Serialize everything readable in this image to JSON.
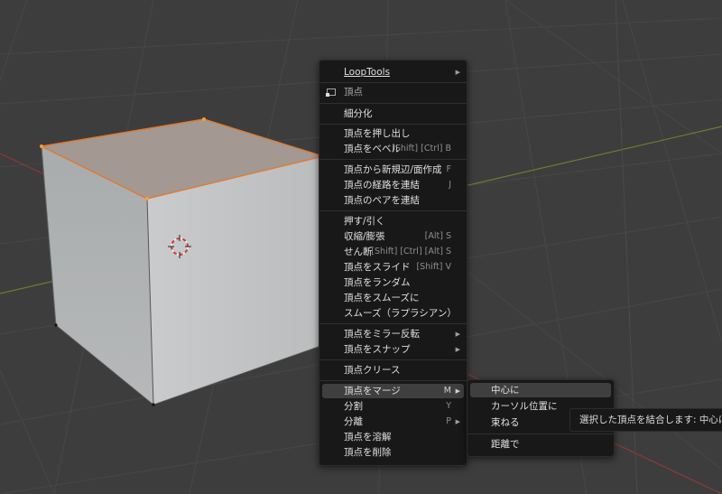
{
  "colors": {
    "background": "#3d3d3d",
    "menu_bg": "#181818",
    "highlight": "#3f3f3f",
    "selection_orange": "#e07a2e"
  },
  "main_menu": {
    "title": "頂点",
    "title_icon": "vertex-select-icon",
    "items": [
      {
        "label": "LoopTools",
        "arrow": "▶"
      },
      {
        "label": "細分化"
      },
      {
        "label": "頂点を押し出し"
      },
      {
        "label": "頂点をベベル",
        "shortcut": "[Shift] [Ctrl] B"
      },
      {
        "label": "頂点から新規辺/面作成",
        "shortcut": "F"
      },
      {
        "label": "頂点の経路を連結",
        "shortcut": "J"
      },
      {
        "label": "頂点のペアを連結"
      },
      {
        "label": "押す/引く"
      },
      {
        "label": "収縮/膨張",
        "shortcut": "[Alt] S"
      },
      {
        "label": "せん断",
        "shortcut": "[Shift] [Ctrl] [Alt] S"
      },
      {
        "label": "頂点をスライド",
        "shortcut": "[Shift] V"
      },
      {
        "label": "頂点をランダム"
      },
      {
        "label": "頂点をスムーズに"
      },
      {
        "label": "スムーズ（ラプラシアン）"
      },
      {
        "label": "頂点をミラー反転",
        "arrow": "▶"
      },
      {
        "label": "頂点をスナップ",
        "arrow": "▶"
      },
      {
        "label": "頂点クリース"
      },
      {
        "label": "頂点をマージ",
        "shortcut": "M",
        "arrow": "▶"
      },
      {
        "label": "分割",
        "shortcut": "Y"
      },
      {
        "label": "分離",
        "shortcut": "P",
        "arrow": "▶"
      },
      {
        "label": "頂点を溶解"
      },
      {
        "label": "頂点を削除"
      }
    ]
  },
  "merge_submenu": {
    "items": [
      {
        "label": "中心に"
      },
      {
        "label": "カーソル位置に"
      },
      {
        "label": "束ねる"
      },
      {
        "label": "距離で"
      }
    ]
  },
  "tooltip": {
    "text": "選択した頂点を結合します: 中心に"
  }
}
